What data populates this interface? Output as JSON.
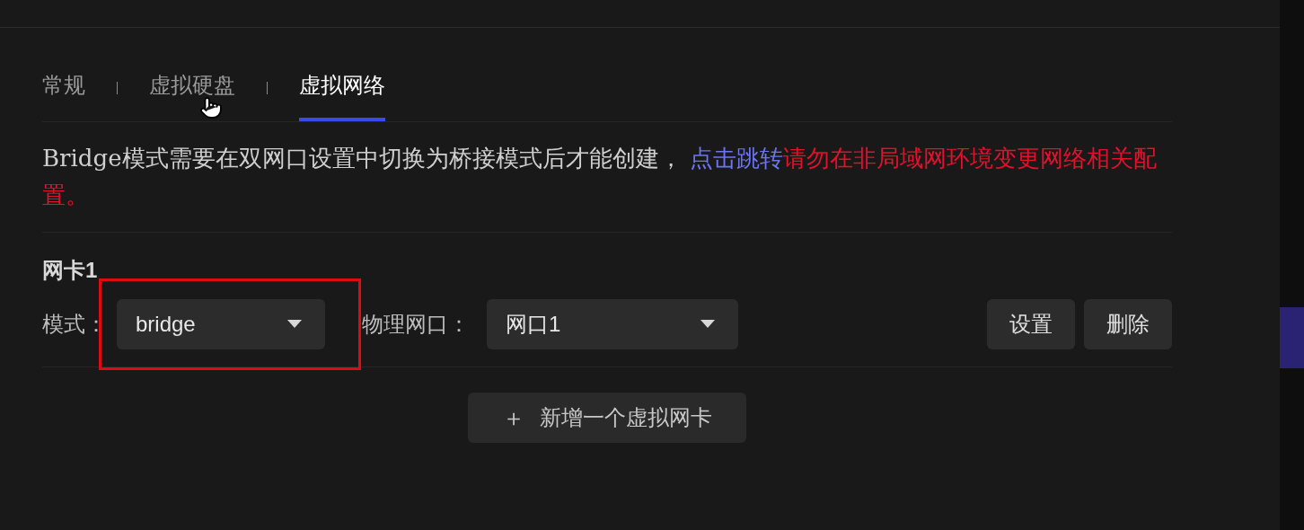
{
  "tabs": [
    {
      "label": "常规",
      "selected": false
    },
    {
      "label": "虚拟硬盘",
      "selected": false
    },
    {
      "label": "虚拟网络",
      "selected": true
    }
  ],
  "notice": {
    "text": "Bridge模式需要在双网口设置中切换为桥接模式后才能创建， ",
    "link": "点击跳转",
    "warning": "请勿在非局域网环境变更网络相关配置。"
  },
  "nics": [
    {
      "title": "网卡1",
      "mode_label": "模式：",
      "mode_value": "bridge",
      "port_label": "物理网口：",
      "port_value": "网口1",
      "buttons": [
        "设置",
        "删除"
      ]
    }
  ],
  "add_button": {
    "icon": "＋",
    "label": "新增一个虚拟网卡"
  }
}
